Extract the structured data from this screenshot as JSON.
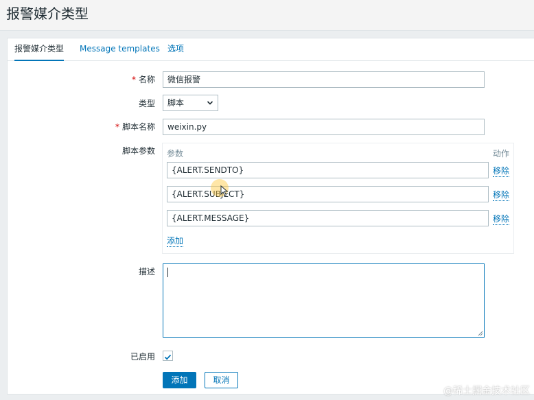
{
  "page": {
    "title": "报警媒介类型"
  },
  "tabs": [
    {
      "label": "报警媒介类型",
      "active": true
    },
    {
      "label": "Message templates",
      "active": false
    },
    {
      "label": "选项",
      "active": false
    }
  ],
  "form": {
    "name": {
      "label": "名称",
      "required": true,
      "value": "微信报警"
    },
    "type": {
      "label": "类型",
      "value": "脚本"
    },
    "script_name": {
      "label": "脚本名称",
      "required": true,
      "value": "weixin.py"
    },
    "script_params": {
      "label": "脚本参数",
      "column_param": "参数",
      "column_action": "动作",
      "rows": [
        {
          "value": "{ALERT.SENDTO}",
          "action": "移除"
        },
        {
          "value": "{ALERT.SUBJECT}",
          "action": "移除"
        },
        {
          "value": "{ALERT.MESSAGE}",
          "action": "移除"
        }
      ],
      "add_label": "添加"
    },
    "description": {
      "label": "描述",
      "value": ""
    },
    "enabled": {
      "label": "已启用",
      "checked": true
    }
  },
  "buttons": {
    "add": "添加",
    "cancel": "取消"
  },
  "watermark": "@稀土掘金技术社区",
  "colors": {
    "accent": "#0275b8",
    "required": "#d40000",
    "border": "#acbbc2",
    "background": "#ebeef0"
  }
}
